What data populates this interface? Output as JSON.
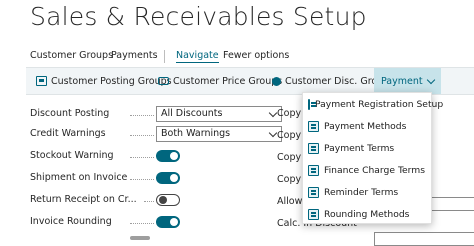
{
  "page": {
    "title": "Sales & Receivables Setup"
  },
  "actions": {
    "customer_groups": "Customer Groups",
    "payments": "Payments",
    "navigate": "Navigate",
    "fewer_options": "Fewer options"
  },
  "subbar": {
    "customer_posting_groups": "Customer Posting Groups",
    "customer_price_groups": "Customer Price Groups",
    "customer_disc_groups": "Customer Disc. Groups",
    "payment": "Payment"
  },
  "fields": {
    "discount_posting": {
      "label": "Discount Posting",
      "value": "All Discounts"
    },
    "credit_warnings": {
      "label": "Credit Warnings",
      "value": "Both Warnings"
    },
    "stockout_warning": {
      "label": "Stockout Warning",
      "on": true
    },
    "shipment_on_invoice": {
      "label": "Shipment on Invoice",
      "on": true
    },
    "return_receipt": {
      "label": "Return Receipt on Cr...",
      "on": false
    },
    "invoice_rounding": {
      "label": "Invoice Rounding",
      "on": true
    }
  },
  "right_fields": {
    "copy1": "Copy C",
    "copy2": "Copy C",
    "copy3": "Copy C",
    "copy4": "Copy C",
    "allow": "Allow T",
    "calc": "Calc. In    Discount"
  },
  "payment_menu": [
    "Payment Registration Setup",
    "Payment Methods",
    "Payment Terms",
    "Finance Charge Terms",
    "Reminder Terms",
    "Rounding Methods"
  ],
  "colors": {
    "accent": "#00667e",
    "subbar_bg": "#f1f5f7",
    "active_bg": "#c7e3ea"
  }
}
